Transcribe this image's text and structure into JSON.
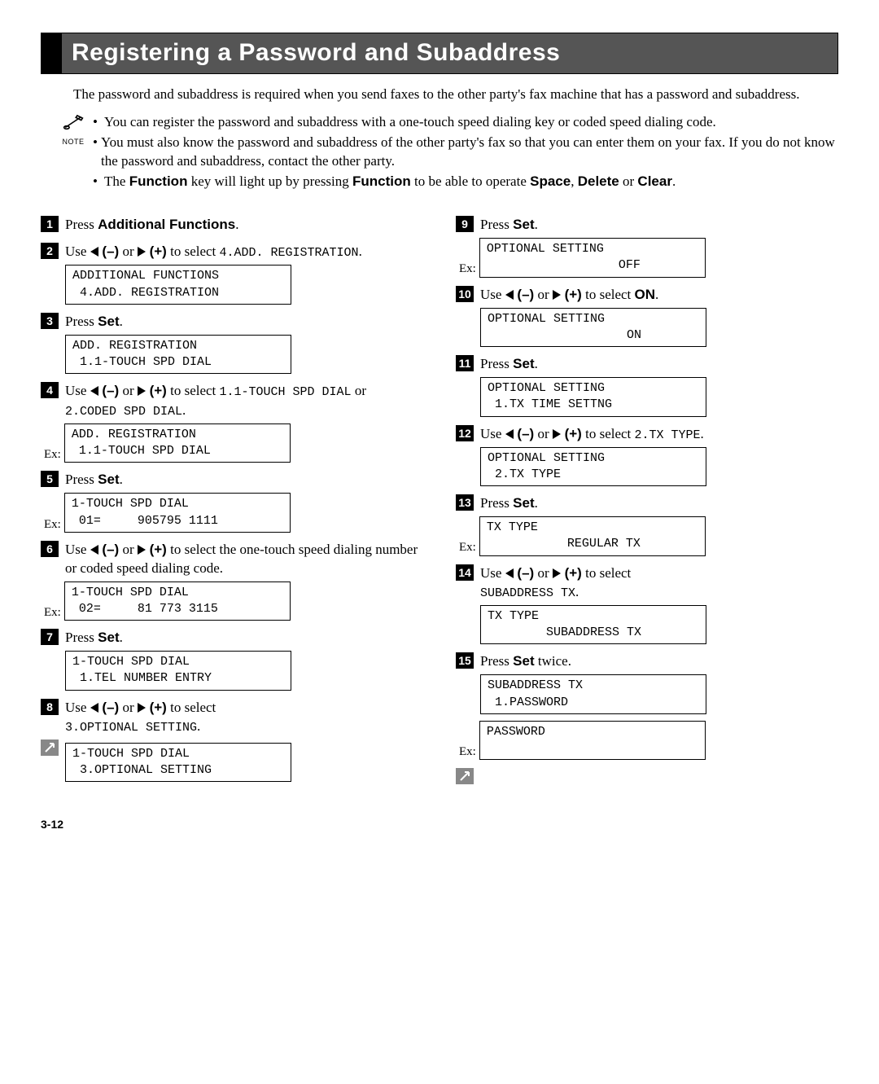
{
  "title": "Registering a Password and Subaddress",
  "intro": "The password and subaddress is required when you send faxes to the other party's fax machine that has a password and subaddress.",
  "note_caption": "NOTE",
  "notes": {
    "n1": "You can register the password and subaddress with a one-touch speed dialing key or coded speed dialing code.",
    "n2": "You must also know the password and subaddress of the other party's fax so that you can enter them on your fax. If you do not know the password and subaddress, contact the other party.",
    "n3_a": "The ",
    "n3_b": "Function",
    "n3_c": " key will light up by pressing ",
    "n3_d": "Function",
    "n3_e": " to be able to operate ",
    "n3_f": "Space",
    "n3_g": ", ",
    "n3_h": "Delete",
    "n3_i": " or ",
    "n3_j": "Clear",
    "n3_k": "."
  },
  "left": {
    "s1_a": "Press ",
    "s1_b": "Additional Functions",
    "s1_c": ".",
    "s2_a": "Use ",
    "s2_b": " (–)",
    "s2_c": " or ",
    "s2_d": " (+)",
    "s2_e": " to select ",
    "s2_f": "4.ADD. REGISTRATION",
    "s2_g": ".",
    "lcd2": "ADDITIONAL FUNCTIONS\n 4.ADD. REGISTRATION",
    "s3_a": "Press ",
    "s3_b": "Set",
    "s3_c": ".",
    "lcd3": "ADD. REGISTRATION\n 1.1-TOUCH SPD DIAL",
    "s4_a": "Use ",
    "s4_b": " (–)",
    "s4_c": " or ",
    "s4_d": " (+)",
    "s4_e": " to select ",
    "s4_f": "1.1-TOUCH SPD DIAL",
    "s4_g": " or ",
    "s4_h": "2.CODED SPD DIAL",
    "s4_i": ".",
    "lcd4": "ADD. REGISTRATION\n 1.1-TOUCH SPD DIAL",
    "s5_a": "Press ",
    "s5_b": "Set",
    "s5_c": ".",
    "lcd5": "1-TOUCH SPD DIAL\n 01=     905795 1111",
    "s6_a": "Use ",
    "s6_b": " (–)",
    "s6_c": " or ",
    "s6_d": " (+)",
    "s6_e": " to select the one-touch speed dialing number or coded speed dialing code.",
    "lcd6": "1-TOUCH SPD DIAL\n 02=     81 773 3115",
    "s7_a": "Press ",
    "s7_b": "Set",
    "s7_c": ".",
    "lcd7": "1-TOUCH SPD DIAL\n 1.TEL NUMBER ENTRY",
    "s8_a": "Use ",
    "s8_b": " (–)",
    "s8_c": " or ",
    "s8_d": " (+)",
    "s8_e": " to select ",
    "s8_f": "3.OPTIONAL SETTING",
    "s8_g": ".",
    "lcd8": "1-TOUCH SPD DIAL\n 3.OPTIONAL SETTING"
  },
  "right": {
    "s9_a": "Press ",
    "s9_b": "Set",
    "s9_c": ".",
    "lcd9": "OPTIONAL SETTING\n                  OFF",
    "s10_a": "Use ",
    "s10_b": " (–)",
    "s10_c": " or ",
    "s10_d": " (+)",
    "s10_e": " to select ",
    "s10_f": "ON",
    "s10_g": ".",
    "lcd10": "OPTIONAL SETTING\n                   ON",
    "s11_a": "Press ",
    "s11_b": "Set",
    "s11_c": ".",
    "lcd11": "OPTIONAL SETTING\n 1.TX TIME SETTNG",
    "s12_a": "Use ",
    "s12_b": " (–)",
    "s12_c": " or ",
    "s12_d": " (+)",
    "s12_e": " to select ",
    "s12_f": "2.TX TYPE",
    "s12_g": ".",
    "lcd12": "OPTIONAL SETTING\n 2.TX TYPE",
    "s13_a": "Press ",
    "s13_b": "Set",
    "s13_c": ".",
    "lcd13": "TX TYPE\n           REGULAR TX",
    "s14_a": "Use ",
    "s14_b": " (–)",
    "s14_c": " or ",
    "s14_d": " (+)",
    "s14_e": " to select ",
    "s14_f": "SUBADDRESS TX",
    "s14_g": ".",
    "lcd14": "TX TYPE\n        SUBADDRESS TX",
    "s15_a": "Press ",
    "s15_b": "Set",
    "s15_c": " twice.",
    "lcd15a": "SUBADDRESS TX\n 1.PASSWORD",
    "lcd15b": "PASSWORD\n "
  },
  "ex": "Ex:",
  "page": "3-12"
}
